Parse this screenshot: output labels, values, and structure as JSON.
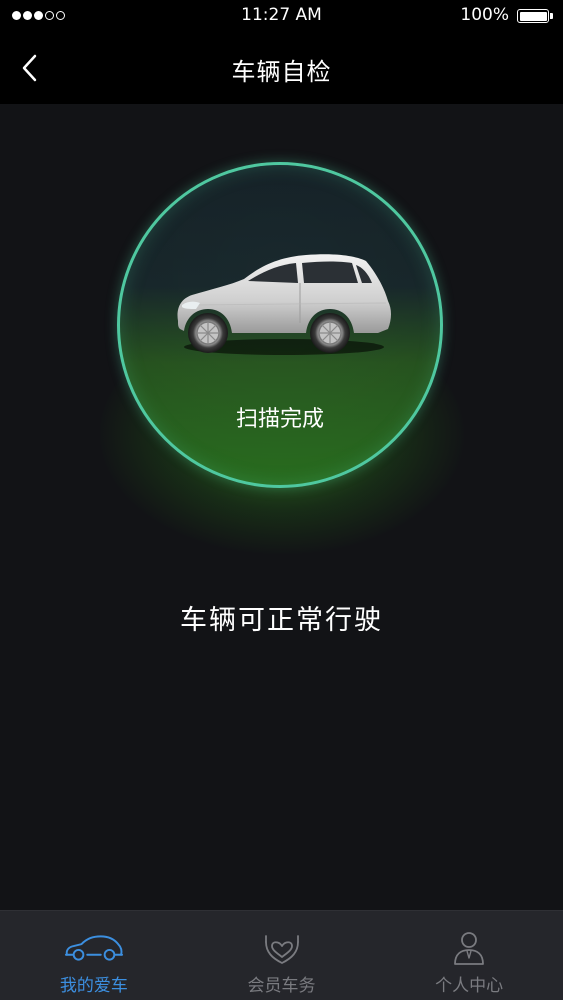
{
  "status_bar": {
    "time": "11:27 AM",
    "battery_percent": "100%",
    "signal_bars_filled": 3,
    "signal_bars_total": 5
  },
  "nav": {
    "title": "车辆自检",
    "back_icon": "chevron-left-icon"
  },
  "scan": {
    "status": "扫描完成",
    "result": "车辆可正常行驶",
    "ring_color": "#4fc8a0",
    "glow_color": "#48be28"
  },
  "tabs": [
    {
      "label": "我的爱车",
      "icon": "car-icon",
      "active": true
    },
    {
      "label": "会员车务",
      "icon": "heart-hands-icon",
      "active": false
    },
    {
      "label": "个人中心",
      "icon": "person-icon",
      "active": false
    }
  ],
  "colors": {
    "accent": "#3c8fe0",
    "inactive": "#7a7b80",
    "background": "#131417",
    "tab_bar": "#25262b"
  }
}
